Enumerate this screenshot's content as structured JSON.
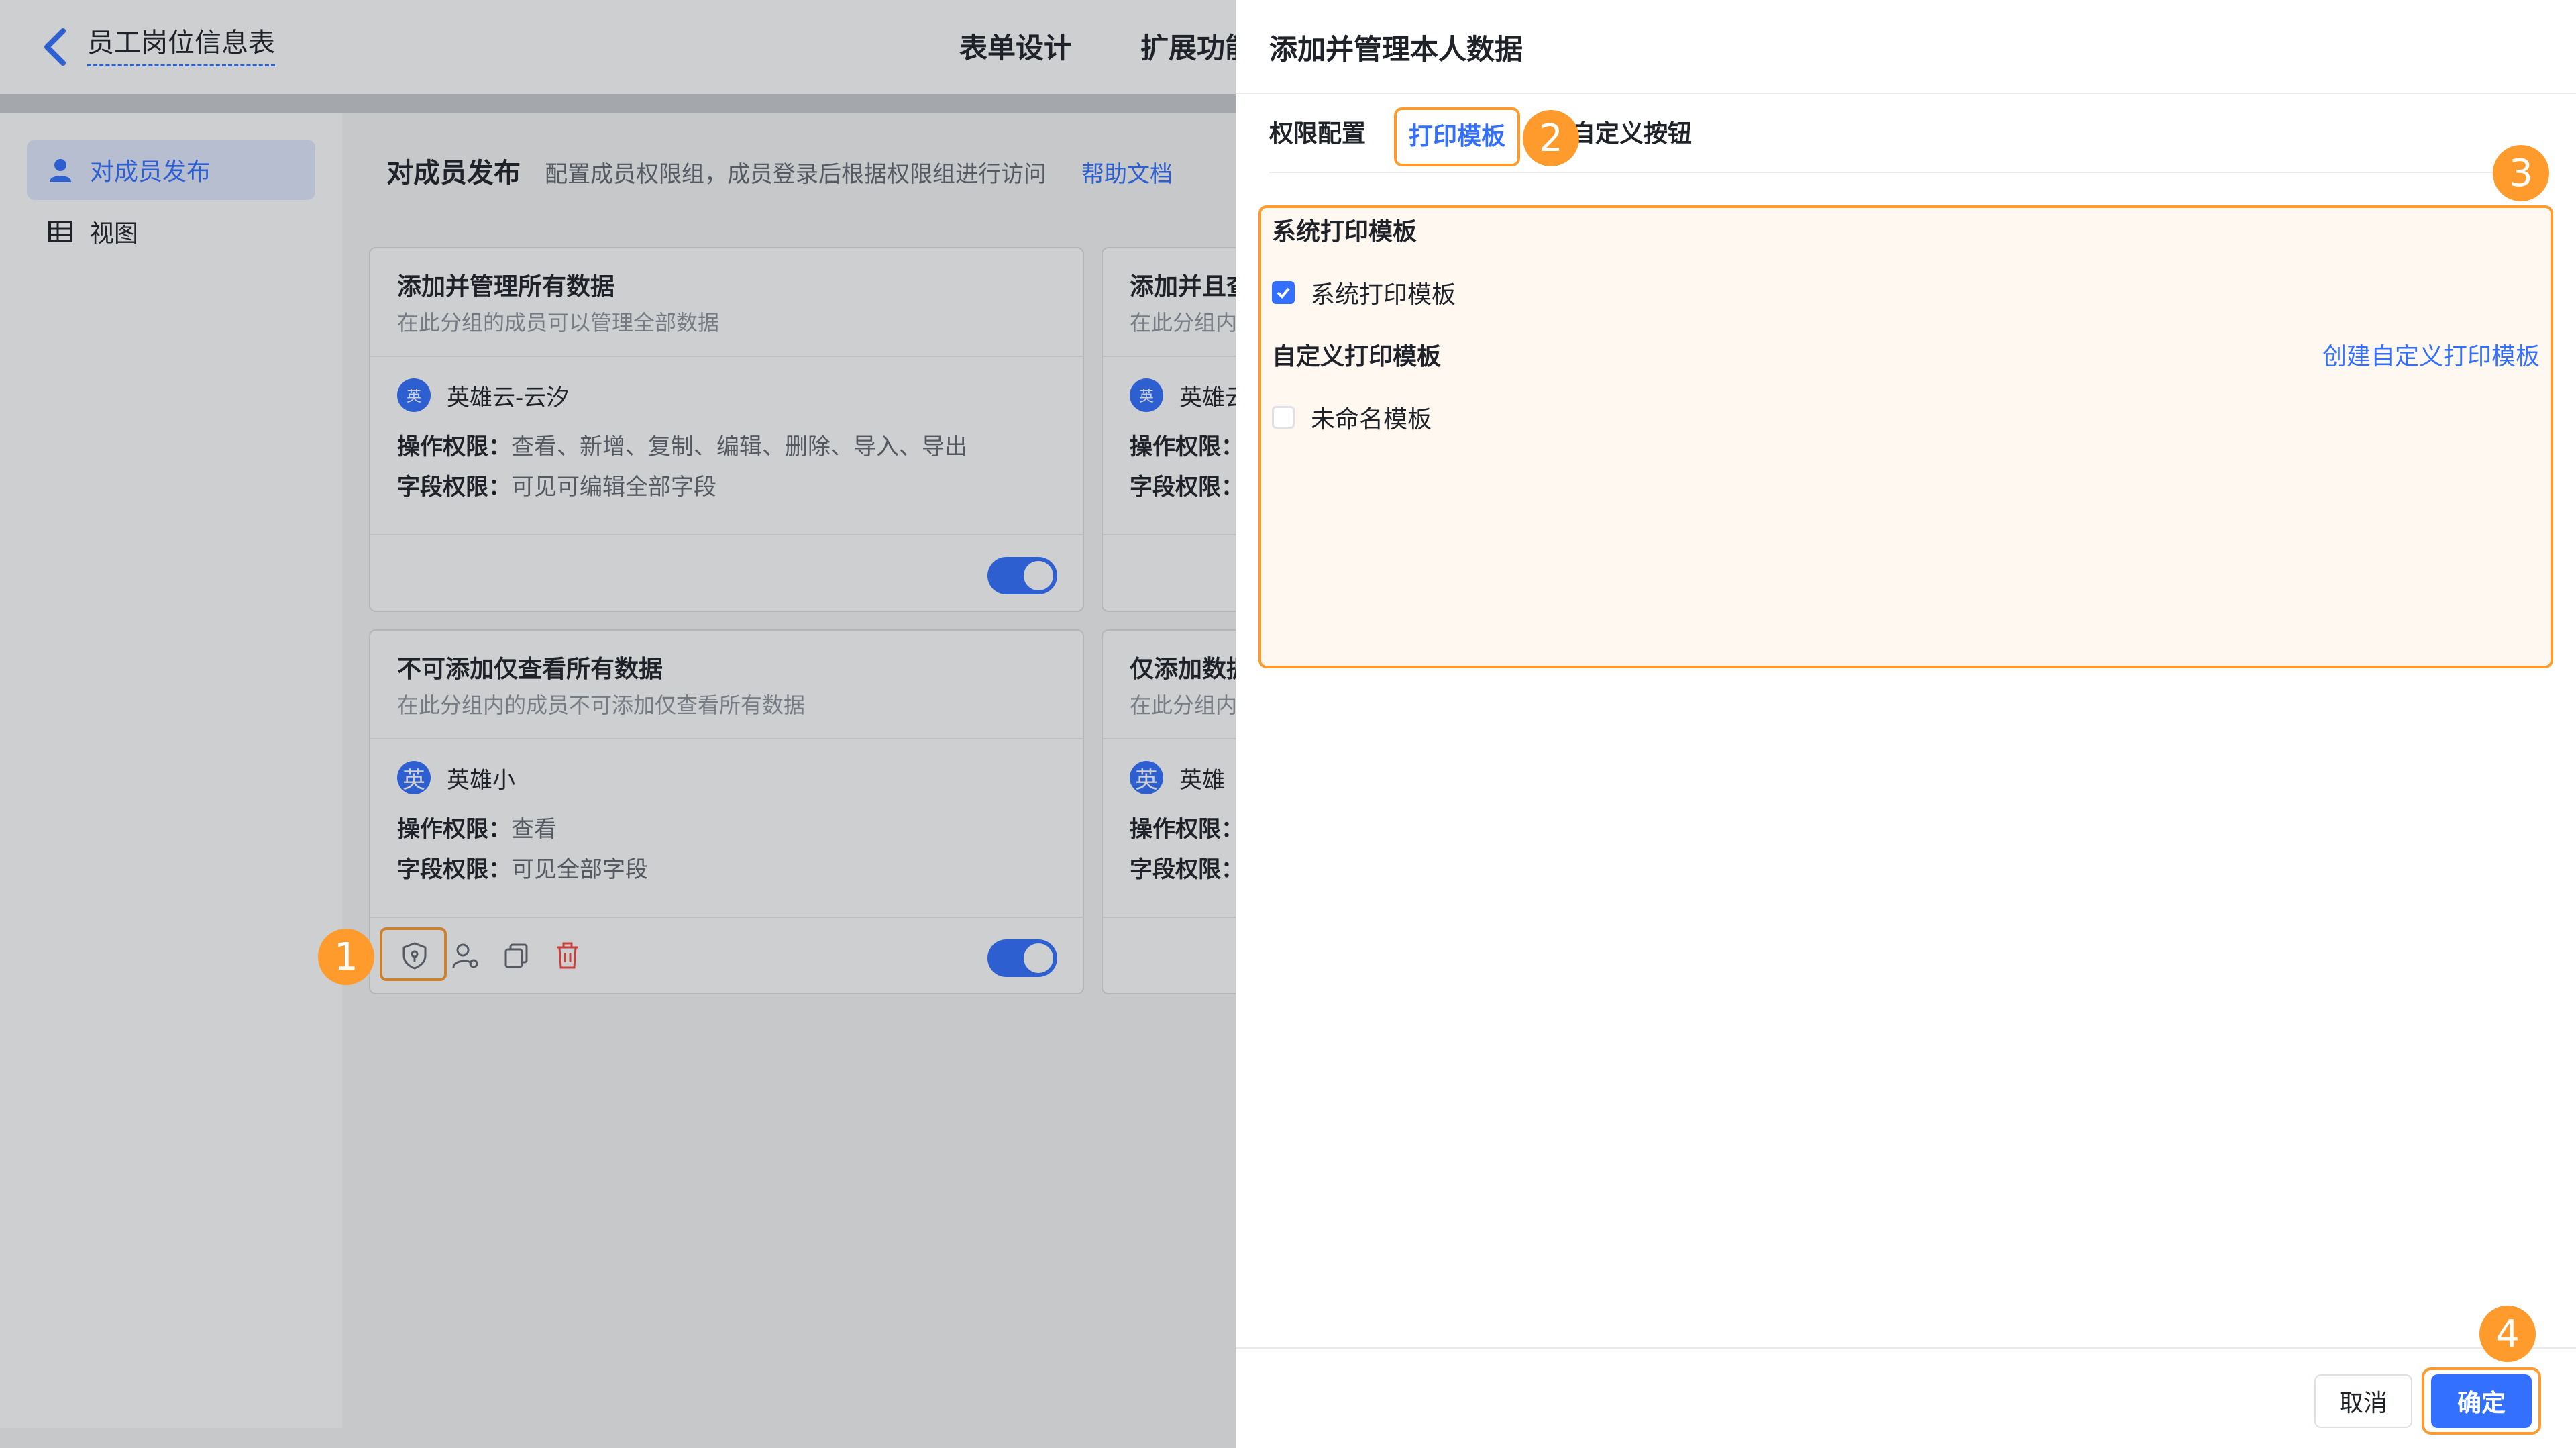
{
  "header": {
    "app_title": "员工岗位信息表",
    "tabs": [
      "表单设计",
      "扩展功能"
    ]
  },
  "sidebar": {
    "items": [
      {
        "label": "对成员发布",
        "icon": "user-icon"
      },
      {
        "label": "视图",
        "icon": "table-icon"
      }
    ]
  },
  "section": {
    "title": "对成员发布",
    "desc": "配置成员权限组，成员登录后根据权限组进行访问",
    "help": "帮助文档"
  },
  "cards": [
    {
      "name": "添加并管理所有数据",
      "sub": "在此分组的成员可以管理全部数据",
      "member_avatar": "英",
      "member": "英雄云-云汐",
      "op_key": "操作权限：",
      "op_val": "查看、新增、复制、编辑、删除、导入、导出",
      "field_key": "字段权限：",
      "field_val": "可见可编辑全部字段"
    },
    {
      "name": "添加并且查看",
      "sub": "在此分组内",
      "member_avatar": "英",
      "member": "英雄云",
      "op_key": "操作权限：",
      "op_val": "",
      "field_key": "字段权限：",
      "field_val": ""
    },
    {
      "name": "不可添加仅查看所有数据",
      "sub": "在此分组内的成员不可添加仅查看所有数据",
      "member_avatar": "英",
      "member": "英雄小",
      "op_key": "操作权限：",
      "op_val": "查看",
      "field_key": "字段权限：",
      "field_val": "可见全部字段"
    },
    {
      "name": "仅添加数据",
      "sub": "在此分组内",
      "member_avatar": "英",
      "member": "英雄",
      "op_key": "操作权限：",
      "op_val": "",
      "field_key": "字段权限：",
      "field_val": ""
    }
  ],
  "drawer": {
    "title": "添加并管理本人数据",
    "tabs": [
      "权限配置",
      "打印模板",
      "自定义按钮"
    ],
    "system_group": "系统打印模板",
    "system_option": "系统打印模板",
    "custom_group": "自定义打印模板",
    "create_link": "创建自定义打印模板",
    "custom_option": "未命名模板",
    "cancel": "取消",
    "ok": "确定"
  },
  "markers": [
    "1",
    "2",
    "3",
    "4"
  ],
  "colors": {
    "accent": "#3370ff",
    "highlight": "#ff9b2d"
  }
}
